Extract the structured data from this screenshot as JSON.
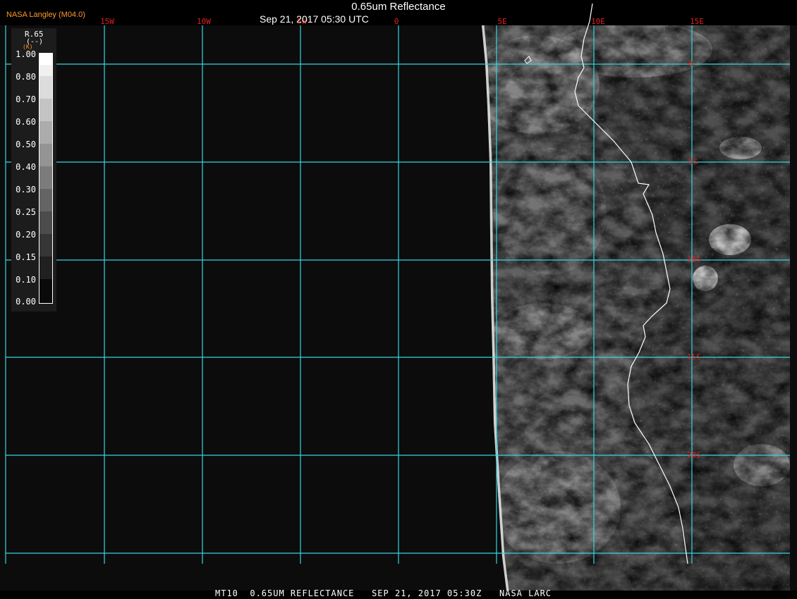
{
  "header": {
    "title": "0.65um Reflectance",
    "datetime": "Sep 21, 2017 05:30 UTC",
    "agency": "NASA Langley (M04.0)"
  },
  "footer": {
    "text": "MT10  0.65UM REFLECTANCE   SEP 21, 2017 05:30Z   NASA LARC"
  },
  "colorbar": {
    "variable": "R.65",
    "unit": "(--)",
    "small_label": "(K)",
    "levels": [
      "1.00",
      "0.80",
      "0.70",
      "0.60",
      "0.50",
      "0.40",
      "0.30",
      "0.25",
      "0.20",
      "0.15",
      "0.10",
      "0.00"
    ]
  },
  "map": {
    "longitude_labels": [
      "15W",
      "10W",
      "5W",
      "0",
      "5E",
      "10E",
      "15E"
    ],
    "latitude_labels": [
      "0",
      "5S",
      "10S",
      "15S",
      "20S"
    ],
    "grid_color": "#33d6e0",
    "label_color": "#e02020",
    "coast_color": "#ffffff"
  }
}
